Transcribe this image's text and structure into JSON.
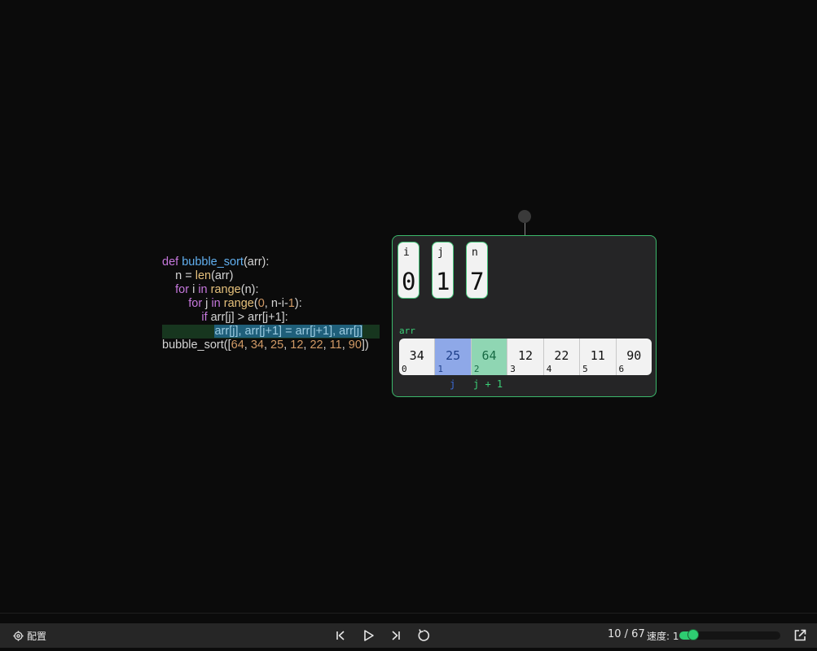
{
  "code": {
    "lines": [
      [
        {
          "t": "def ",
          "c": "kw"
        },
        {
          "t": "bubble_sort",
          "c": "fn"
        },
        {
          "t": "(arr):",
          "c": "plain"
        }
      ],
      [
        {
          "t": "    n = ",
          "c": "plain"
        },
        {
          "t": "len",
          "c": "bi"
        },
        {
          "t": "(arr)",
          "c": "plain"
        }
      ],
      [
        {
          "t": "    ",
          "c": "plain"
        },
        {
          "t": "for",
          "c": "kw"
        },
        {
          "t": " i ",
          "c": "plain"
        },
        {
          "t": "in",
          "c": "kw"
        },
        {
          "t": " ",
          "c": "plain"
        },
        {
          "t": "range",
          "c": "bi"
        },
        {
          "t": "(n):",
          "c": "plain"
        }
      ],
      [
        {
          "t": "        ",
          "c": "plain"
        },
        {
          "t": "for",
          "c": "kw"
        },
        {
          "t": " j ",
          "c": "plain"
        },
        {
          "t": "in",
          "c": "kw"
        },
        {
          "t": " ",
          "c": "plain"
        },
        {
          "t": "range",
          "c": "bi"
        },
        {
          "t": "(",
          "c": "plain"
        },
        {
          "t": "0",
          "c": "num"
        },
        {
          "t": ", n-i-",
          "c": "plain"
        },
        {
          "t": "1",
          "c": "num"
        },
        {
          "t": "):",
          "c": "plain"
        }
      ],
      [
        {
          "t": "            ",
          "c": "plain"
        },
        {
          "t": "if",
          "c": "kw"
        },
        {
          "t": " arr[j] > arr[j+1]:",
          "c": "plain"
        }
      ],
      [
        {
          "t": "                ",
          "c": "plain"
        },
        {
          "t": "arr[j], arr[j+1] = arr[j+1], arr[j]",
          "c": "sel"
        }
      ],
      [
        {
          "t": "bubble_sort([",
          "c": "plain"
        },
        {
          "t": "64",
          "c": "num"
        },
        {
          "t": ", ",
          "c": "plain"
        },
        {
          "t": "34",
          "c": "num"
        },
        {
          "t": ", ",
          "c": "plain"
        },
        {
          "t": "25",
          "c": "num"
        },
        {
          "t": ", ",
          "c": "plain"
        },
        {
          "t": "12",
          "c": "num"
        },
        {
          "t": ", ",
          "c": "plain"
        },
        {
          "t": "22",
          "c": "num"
        },
        {
          "t": ", ",
          "c": "plain"
        },
        {
          "t": "11",
          "c": "num"
        },
        {
          "t": ", ",
          "c": "plain"
        },
        {
          "t": "90",
          "c": "num"
        },
        {
          "t": "])",
          "c": "plain"
        }
      ]
    ],
    "active_line": 5
  },
  "frame": {
    "variables": [
      {
        "name": "i",
        "value": "0"
      },
      {
        "name": "j",
        "value": "1"
      },
      {
        "name": "n",
        "value": "7"
      }
    ],
    "array_label": "arr",
    "array": [
      {
        "value": "34",
        "index": "0",
        "state": ""
      },
      {
        "value": "25",
        "index": "1",
        "state": "j"
      },
      {
        "value": "64",
        "index": "2",
        "state": "j1"
      },
      {
        "value": "12",
        "index": "3",
        "state": ""
      },
      {
        "value": "22",
        "index": "4",
        "state": ""
      },
      {
        "value": "11",
        "index": "5",
        "state": ""
      },
      {
        "value": "90",
        "index": "6",
        "state": ""
      }
    ],
    "pointer_j": "j",
    "pointer_j1": "j + 1"
  },
  "bottom_bar": {
    "config_label": "配置",
    "counter": "10 / 67",
    "speed_label": "速度: 1",
    "speed_fraction": 0.14,
    "accent_color": "#2ecc71",
    "icons": [
      "settings-icon",
      "skip-back-icon",
      "play-icon",
      "skip-forward-icon",
      "reset-icon",
      "open-external-icon"
    ]
  }
}
